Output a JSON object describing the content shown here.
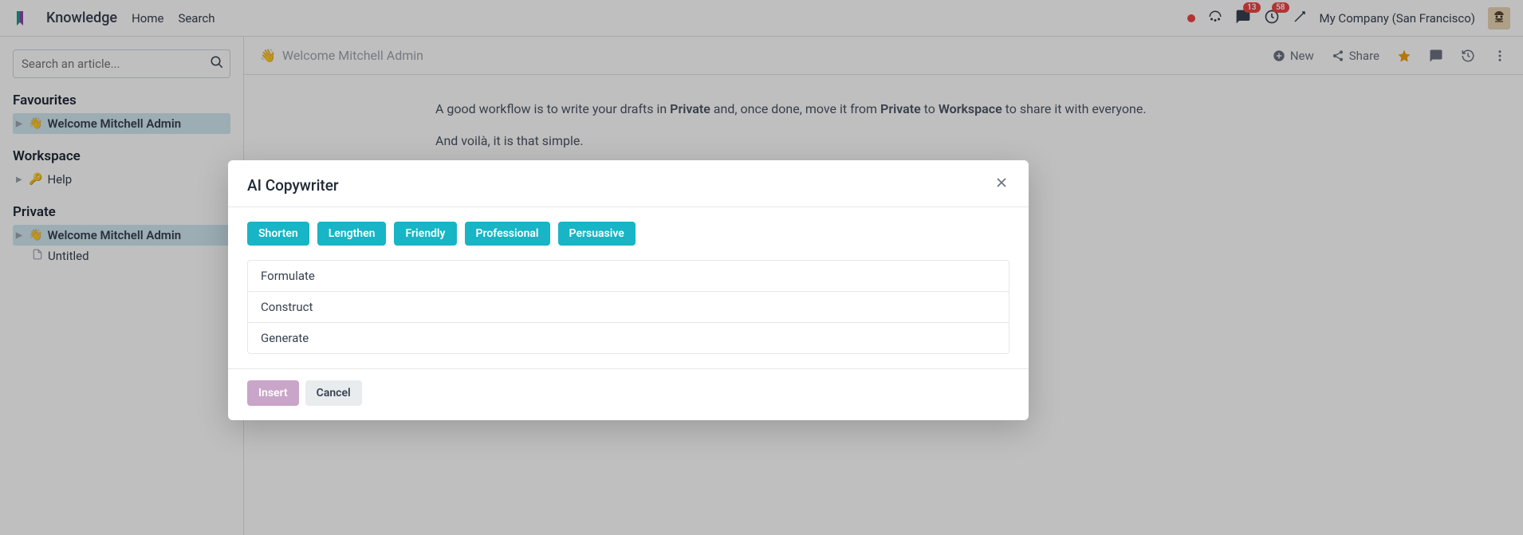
{
  "header": {
    "app_title": "Knowledge",
    "nav": {
      "home": "Home",
      "search": "Search"
    },
    "badges": {
      "messages": "13",
      "activities": "58"
    },
    "company": "My Company (San Francisco)"
  },
  "sidebar": {
    "search_placeholder": "Search an article...",
    "sections": {
      "favourites": {
        "title": "Favourites",
        "items": [
          {
            "label": "Welcome Mitchell Admin",
            "emoji": "👋"
          }
        ]
      },
      "workspace": {
        "title": "Workspace",
        "items": [
          {
            "label": "Help",
            "emoji": "🔑"
          }
        ]
      },
      "private": {
        "title": "Private",
        "items": [
          {
            "label": "Welcome Mitchell Admin",
            "emoji": "👋"
          },
          {
            "label": "Untitled",
            "emoji": ""
          }
        ]
      }
    }
  },
  "content": {
    "title": "Welcome Mitchell Admin",
    "emoji": "👋",
    "actions": {
      "new": "New",
      "share": "Share"
    },
    "body": {
      "p1_a": "A good workflow is to write your drafts in ",
      "p1_b": "Private",
      "p1_c": " and, once done, move it from ",
      "p1_d": "Private",
      "p1_e": " to ",
      "p1_f": "Workspace",
      "p1_g": " to share it with everyone.",
      "p2": "And voilà, it is that simple."
    }
  },
  "modal": {
    "title": "AI Copywriter",
    "pills": [
      "Shorten",
      "Lengthen",
      "Friendly",
      "Professional",
      "Persuasive"
    ],
    "options": [
      "Formulate",
      "Construct",
      "Generate"
    ],
    "insert": "Insert",
    "cancel": "Cancel"
  }
}
